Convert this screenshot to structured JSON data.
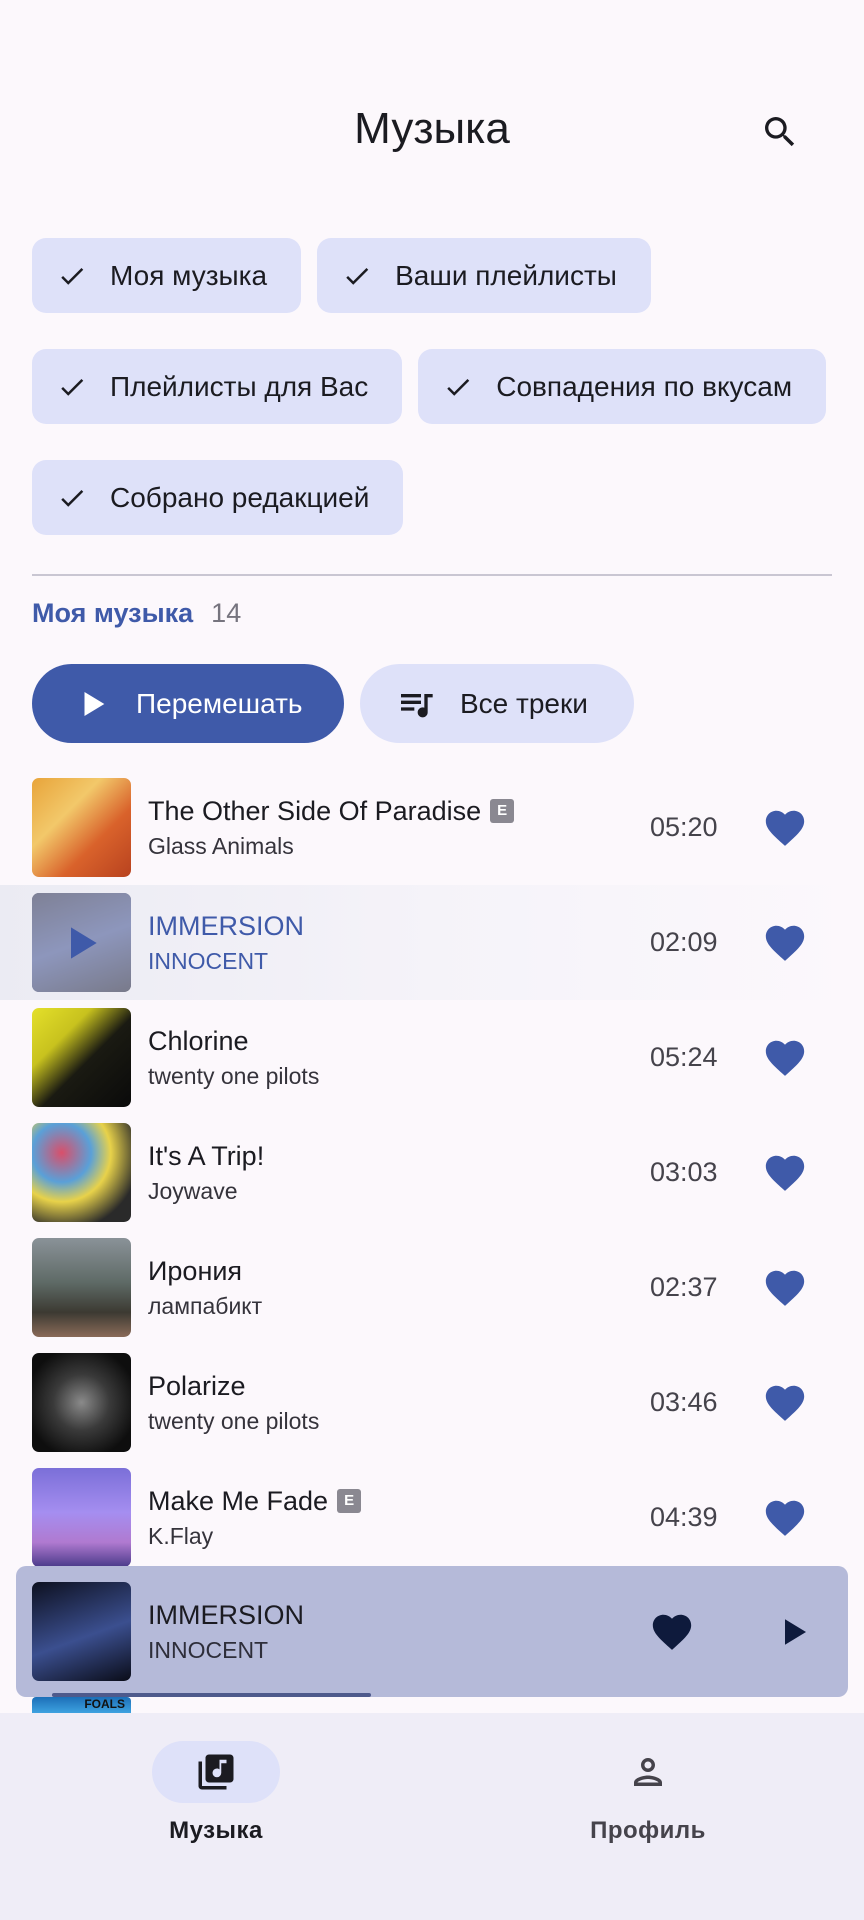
{
  "header": {
    "title": "Музыка"
  },
  "filters": [
    {
      "label": "Моя музыка",
      "selected": true
    },
    {
      "label": "Ваши плейлисты",
      "selected": true
    },
    {
      "label": "Плейлисты для Вас",
      "selected": true
    },
    {
      "label": "Совпадения по вкусам",
      "selected": true
    },
    {
      "label": "Собрано редакцией",
      "selected": true
    }
  ],
  "section": {
    "title": "Моя музыка",
    "count": "14"
  },
  "actions": {
    "shuffle_label": "Перемешать",
    "all_tracks_label": "Все треки"
  },
  "tracks": [
    {
      "title": "The Other Side Of Paradise",
      "artist": "Glass Animals",
      "duration": "05:20",
      "explicit": true,
      "explicit_label": "E",
      "liked": true
    },
    {
      "title": "IMMERSION",
      "artist": "INNOCENT",
      "duration": "02:09",
      "explicit": false,
      "liked": true,
      "playing": true
    },
    {
      "title": "Chlorine",
      "artist": "twenty one pilots",
      "duration": "05:24",
      "explicit": false,
      "liked": true
    },
    {
      "title": "It's A Trip!",
      "artist": "Joywave",
      "duration": "03:03",
      "explicit": false,
      "liked": true
    },
    {
      "title": "Ирония",
      "artist": "лампабикт",
      "duration": "02:37",
      "explicit": false,
      "liked": true
    },
    {
      "title": "Polarize",
      "artist": "twenty one pilots",
      "duration": "03:46",
      "explicit": false,
      "liked": true
    },
    {
      "title": "Make Me Fade",
      "artist": "K.Flay",
      "duration": "04:39",
      "explicit": true,
      "explicit_label": "E",
      "liked": true
    }
  ],
  "player": {
    "title": "IMMERSION",
    "artist": "INNOCENT",
    "liked": true,
    "progress": 0.42
  },
  "peek_cover_text": "FOALS",
  "nav": {
    "music_label": "Музыка",
    "profile_label": "Профиль"
  },
  "colors": {
    "accent": "#3f5aa9",
    "chip": "#dee1f9",
    "player": "#b5bad9",
    "nav": "#efedf7"
  }
}
